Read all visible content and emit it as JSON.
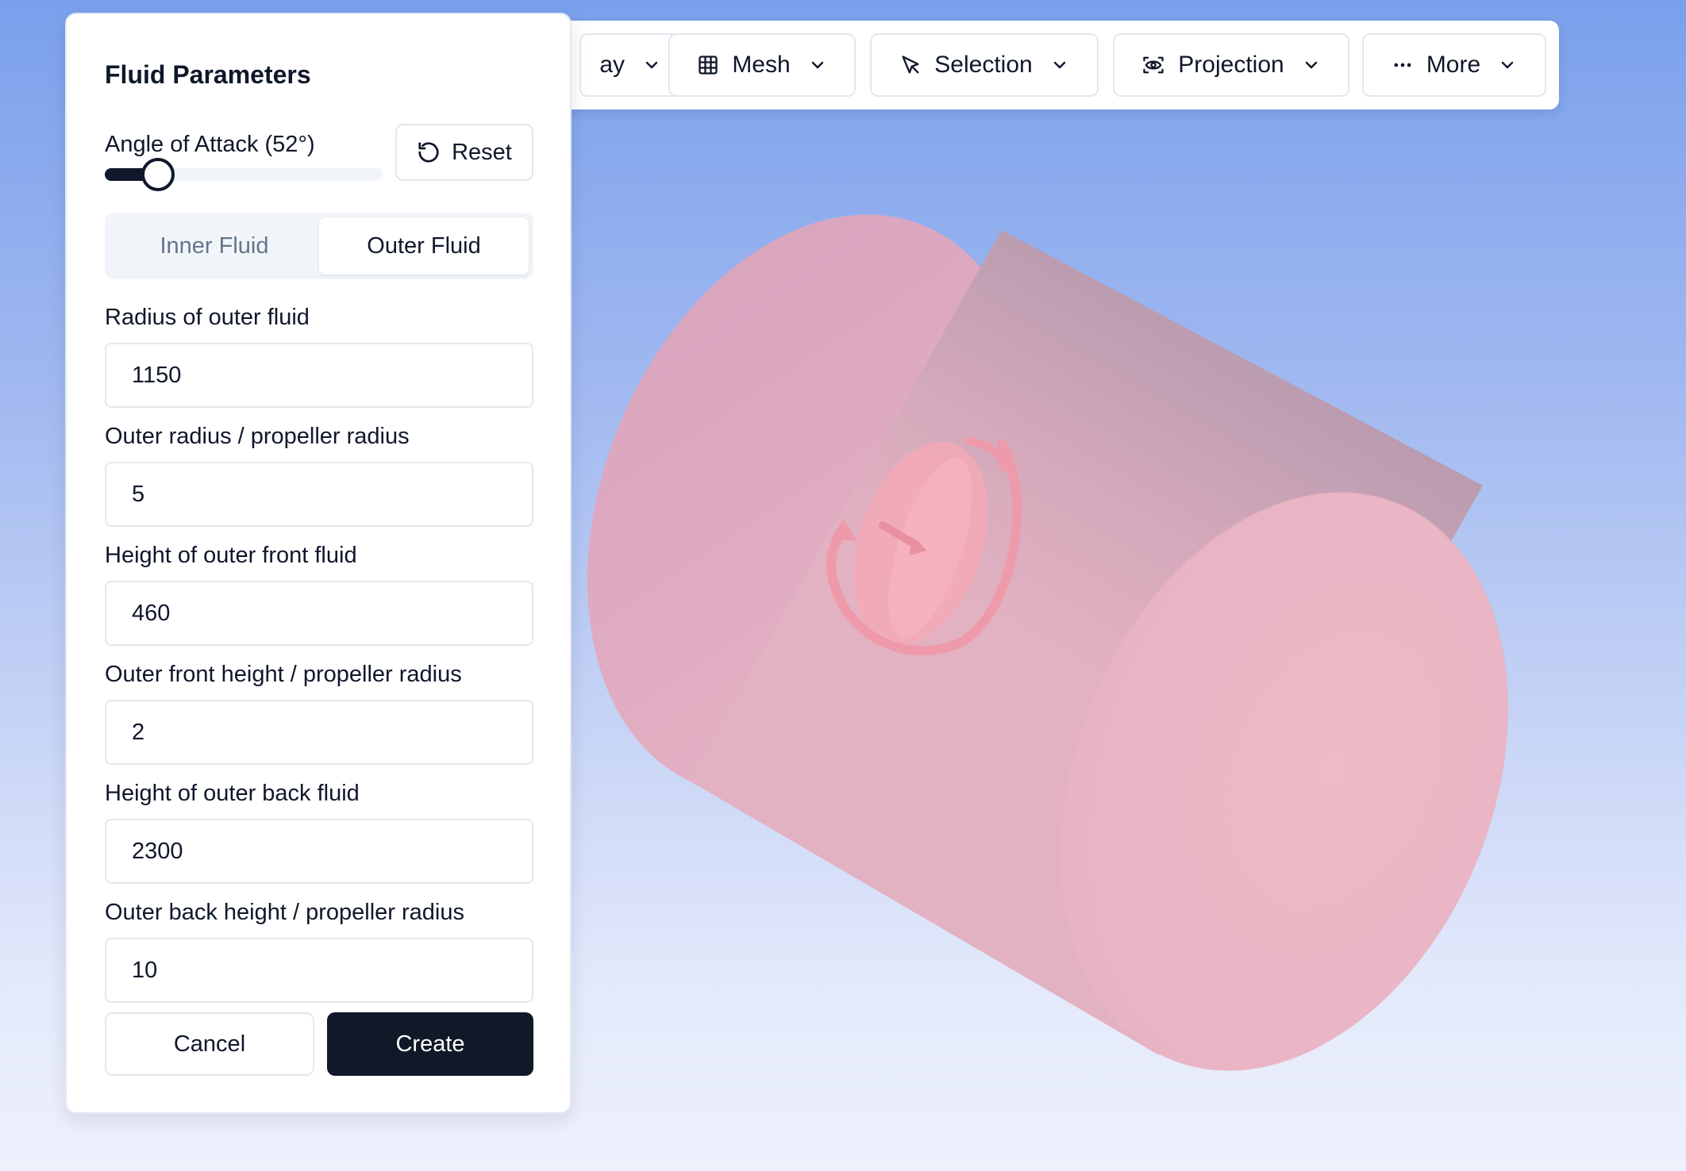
{
  "toolbar": {
    "display_label_partial": "ay",
    "mesh_label": "Mesh",
    "selection_label": "Selection",
    "projection_label": "Projection",
    "more_label": "More"
  },
  "panel": {
    "title": "Fluid Parameters",
    "angle_label": "Angle of Attack (52°)",
    "angle_fraction": 0.19,
    "reset_label": "Reset",
    "tabs": {
      "inner": "Inner Fluid",
      "outer": "Outer Fluid",
      "active": "outer"
    },
    "fields": [
      {
        "label": "Radius of outer fluid",
        "value": "1150"
      },
      {
        "label": "Outer radius / propeller radius",
        "value": "5"
      },
      {
        "label": "Height of outer front fluid",
        "value": "460"
      },
      {
        "label": "Outer front height / propeller radius",
        "value": "2"
      },
      {
        "label": "Height of outer back fluid",
        "value": "2300"
      },
      {
        "label": "Outer back height / propeller radius",
        "value": "10"
      }
    ],
    "cancel_label": "Cancel",
    "create_label": "Create"
  },
  "colors": {
    "accent": "#111827",
    "cylinder": "#f0b6c4",
    "background_top": "#7aa0ec",
    "background_bottom": "#eef1fc"
  }
}
